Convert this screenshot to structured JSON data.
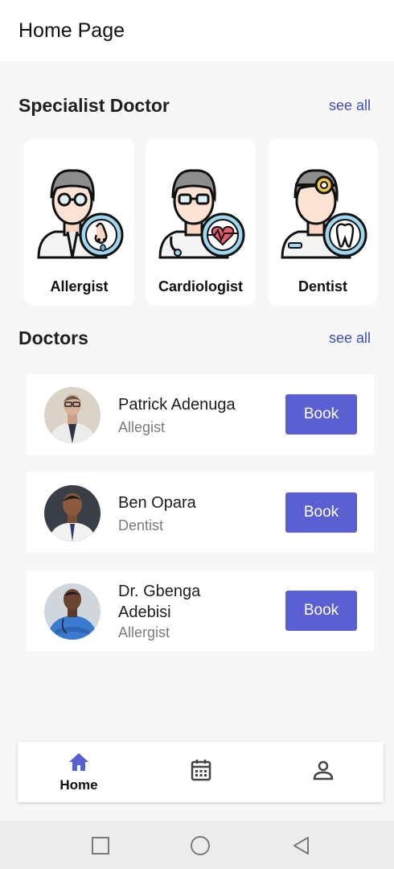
{
  "header": {
    "title": "Home Page"
  },
  "specialists": {
    "heading": "Specialist Doctor",
    "see_all": "see all",
    "items": [
      {
        "label": "Allergist",
        "icon": "allergist-icon"
      },
      {
        "label": "Cardiologist",
        "icon": "cardiologist-icon"
      },
      {
        "label": "Dentist",
        "icon": "dentist-icon"
      }
    ]
  },
  "doctors": {
    "heading": "Doctors",
    "see_all": "see all",
    "items": [
      {
        "name": "Patrick Adenuga",
        "specialty": "Allegist",
        "action": "Book"
      },
      {
        "name": "Ben Opara",
        "specialty": "Dentist",
        "action": "Book"
      },
      {
        "name": "Dr. Gbenga Adebisi",
        "specialty": "Allergist",
        "action": "Book"
      }
    ]
  },
  "bottom_nav": {
    "items": [
      {
        "label": "Home",
        "icon": "home-icon",
        "active": true
      },
      {
        "label": "",
        "icon": "calendar-icon",
        "active": false
      },
      {
        "label": "",
        "icon": "profile-icon",
        "active": false
      }
    ]
  },
  "colors": {
    "accent": "#5a5fd2",
    "link": "#3f4fb3",
    "background": "#f7f7f7"
  },
  "system_nav": {
    "icons": [
      "recents-icon",
      "home-circle-icon",
      "back-icon"
    ]
  }
}
